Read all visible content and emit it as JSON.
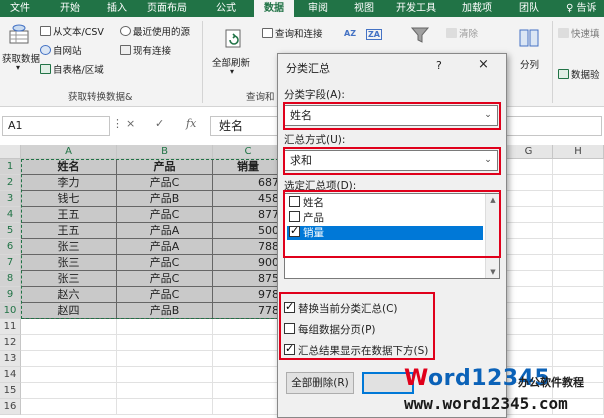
{
  "ribbon_tabs": [
    {
      "label": "文件"
    },
    {
      "label": "开始"
    },
    {
      "label": "插入"
    },
    {
      "label": "页面布局"
    },
    {
      "label": "公式"
    },
    {
      "label": "数据",
      "active": true
    },
    {
      "label": "审阅"
    },
    {
      "label": "视图"
    },
    {
      "label": "开发工具"
    },
    {
      "label": "加载项"
    },
    {
      "label": "团队"
    },
    {
      "label": "♀ 告诉"
    }
  ],
  "ribbon": {
    "get_data_label": "获取数据",
    "get_data_arrow": "▾",
    "from_text_csv": "从文本/CSV",
    "from_web": "自网站",
    "from_table": "自表格/区域",
    "recent_sources": "最近使用的源",
    "existing_connections": "现有连接",
    "group_get_transform": "获取转换数据&",
    "refresh_all": "全部刷新",
    "refresh_arrow": "▾",
    "queries_connections": "查询和连接",
    "group_queries_partial": "查询和",
    "clear": "清除",
    "sort_az": "AZ",
    "sort_za": "ZA",
    "column_split": "分列",
    "quick_fill": "快速填",
    "data_validation_partial": "数据验",
    "colors": {
      "excel_green": "#217346",
      "ribbon_bg": "#f3f3f3"
    }
  },
  "formula_bar": {
    "name_box": "A1",
    "cancel_icon": "×",
    "enter_icon": "✓",
    "fx_label": "fx",
    "value": "姓名"
  },
  "grid": {
    "columns": [
      "A",
      "B",
      "C",
      "G",
      "H"
    ],
    "rows": [
      "1",
      "2",
      "3",
      "4",
      "5",
      "6",
      "7",
      "8",
      "9",
      "10",
      "11",
      "12",
      "13",
      "14",
      "15",
      "16"
    ],
    "data": [
      [
        "姓名",
        "产品",
        "销量"
      ],
      [
        "李力",
        "产品C",
        "687"
      ],
      [
        "钱七",
        "产品B",
        "458"
      ],
      [
        "王五",
        "产品C",
        "877"
      ],
      [
        "王五",
        "产品A",
        "500"
      ],
      [
        "张三",
        "产品A",
        "788"
      ],
      [
        "张三",
        "产品C",
        "900"
      ],
      [
        "张三",
        "产品C",
        "875"
      ],
      [
        "赵六",
        "产品C",
        "978"
      ],
      [
        "赵四",
        "产品B",
        "778"
      ]
    ]
  },
  "dialog": {
    "title": "分类汇总",
    "help": "?",
    "close": "×",
    "group_by_label": "分类字段(A):",
    "group_by_value": "姓名",
    "function_label": "汇总方式(U):",
    "function_value": "求和",
    "subtotal_items_label": "选定汇总项(D):",
    "subtotal_items": [
      {
        "label": "姓名",
        "checked": false
      },
      {
        "label": "产品",
        "checked": false
      },
      {
        "label": "销量",
        "checked": true
      }
    ],
    "options": [
      {
        "label": "替换当前分类汇总(C)",
        "checked": true
      },
      {
        "label": "每组数据分页(P)",
        "checked": false
      },
      {
        "label": "汇总结果显示在数据下方(S)",
        "checked": true
      }
    ],
    "remove_all_button": "全部删除(R)",
    "dropdown_arrow": "⌄",
    "scroll_up": "▲",
    "scroll_down": "▼"
  },
  "watermark": {
    "brand_word": "Word12345",
    "subtitle": "办公软件教程",
    "url": "www.word12345.com",
    "colors": {
      "w_red": "#e0001b",
      "blue": "#0b62b8"
    }
  },
  "annotations": {
    "highlight_color": "#e0001b"
  }
}
